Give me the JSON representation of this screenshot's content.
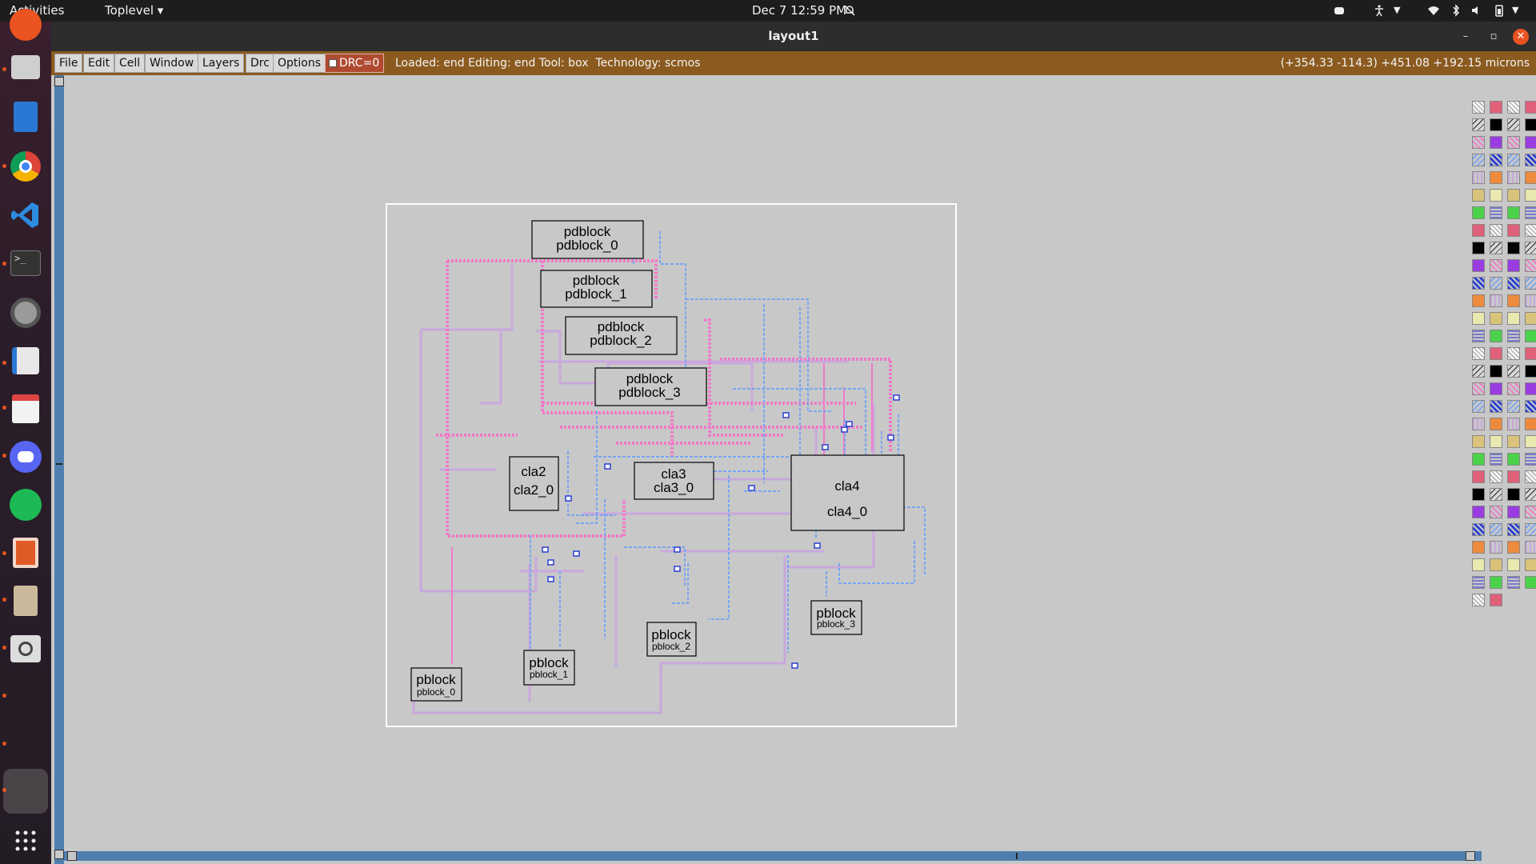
{
  "topbar": {
    "activities": "Activities",
    "app_menu": "Toplevel",
    "clock": "Dec 7  12:59 PM"
  },
  "window": {
    "title": "layout1",
    "controls": [
      "–",
      "▫",
      "✕"
    ]
  },
  "menu": {
    "items": [
      "File",
      "Edit",
      "Cell",
      "Window",
      "Layers",
      "Drc",
      "Options"
    ],
    "drc_label": "DRC=0",
    "status": "Loaded: end Editing: end Tool: box  Technology: scmos",
    "coords": "(+354.33 -114.3) +451.08 +192.15 microns"
  },
  "cells": [
    {
      "name": "pdblock",
      "instance": "pdblock_0"
    },
    {
      "name": "pdblock",
      "instance": "pdblock_1"
    },
    {
      "name": "pdblock",
      "instance": "pdblock_2"
    },
    {
      "name": "pdblock",
      "instance": "pdblock_3"
    },
    {
      "name": "cla2",
      "instance": "cla2_0"
    },
    {
      "name": "cla3",
      "instance": "cla3_0"
    },
    {
      "name": "cla4",
      "instance": "cla4_0"
    },
    {
      "name": "pblock",
      "instance": "pblock_0"
    },
    {
      "name": "pblock",
      "instance": "pblock_1"
    },
    {
      "name": "pblock",
      "instance": "pblock_2"
    },
    {
      "name": "pblock",
      "instance": "pblock_3"
    }
  ],
  "colors": {
    "metal1_blue": "#7aa6f0",
    "poly_pink": "#f07ac8",
    "metal2_purple": "#c9a8dc",
    "contact_blue": "#2a3fd0",
    "accent": "#8b5a1e"
  },
  "dock": {
    "icons": [
      "app-icon",
      "files-icon",
      "writer-icon",
      "chrome-icon",
      "vscode-icon",
      "terminal-icon",
      "settings-icon",
      "text-editor-icon",
      "document-viewer-icon",
      "discord-icon",
      "spotify-icon",
      "impress-icon",
      "archive-icon",
      "magnifier-icon",
      "active-window-icon",
      "app-grid-icon"
    ]
  }
}
